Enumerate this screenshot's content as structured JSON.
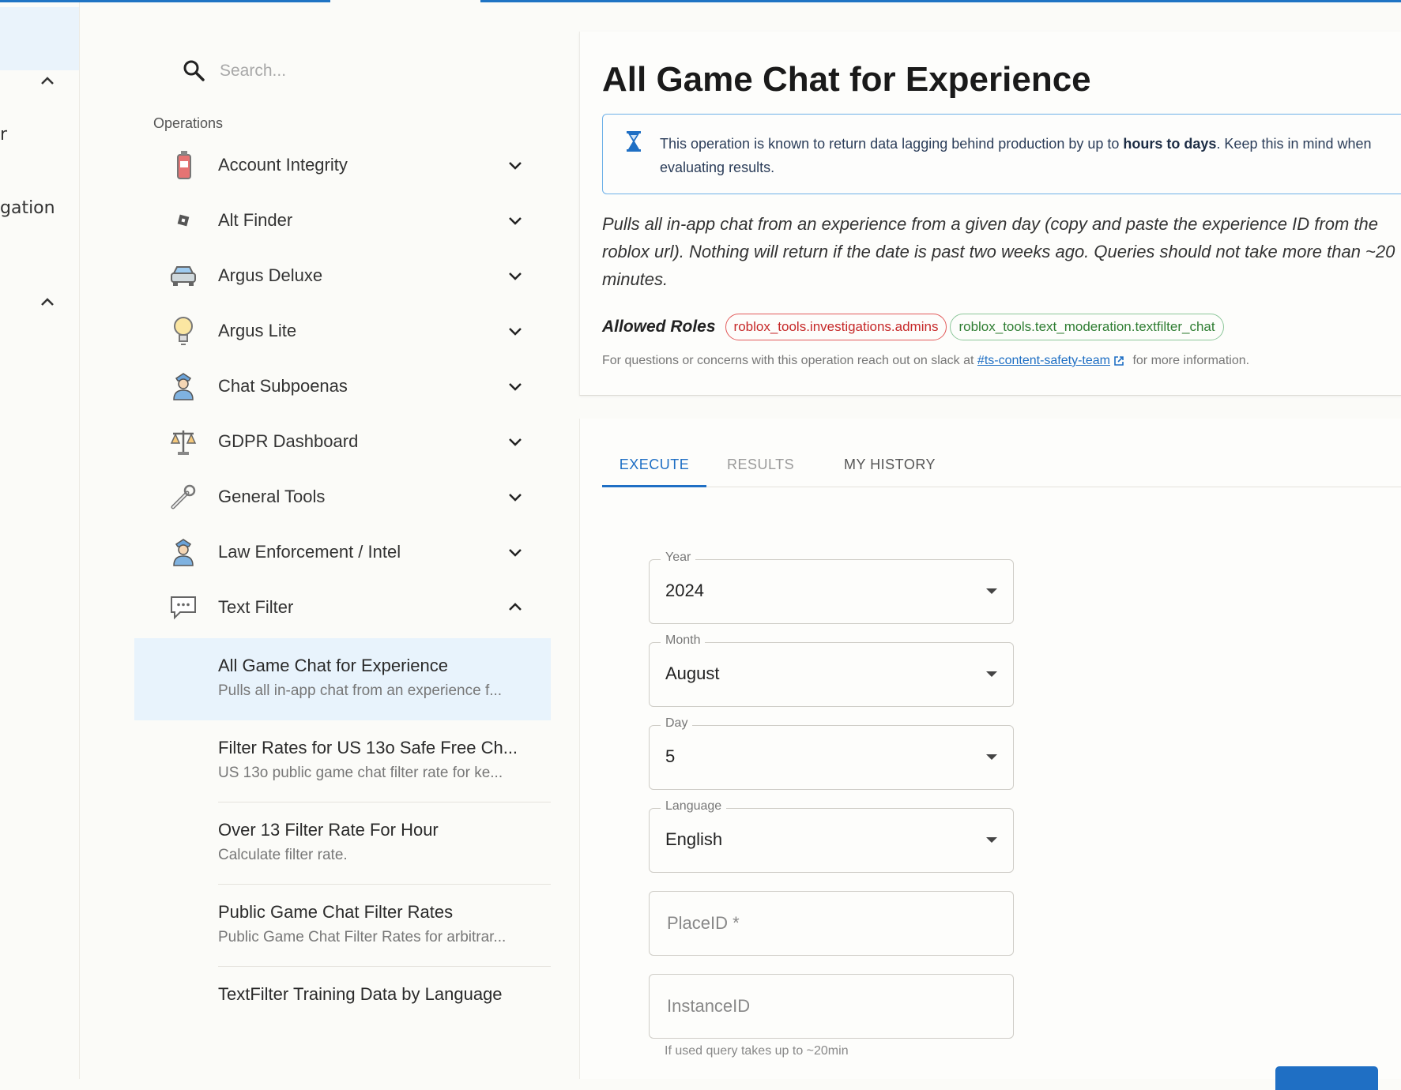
{
  "left_nav": {
    "fragment_1": "r",
    "fragment_2": "gation"
  },
  "search": {
    "placeholder": "Search..."
  },
  "operations": {
    "title": "Operations",
    "categories": [
      {
        "label": "Account Integrity",
        "icon": "fire-extinguisher-icon",
        "expanded": false
      },
      {
        "label": "Alt Finder",
        "icon": "roblox-logo-icon",
        "expanded": false
      },
      {
        "label": "Argus Deluxe",
        "icon": "car-icon",
        "expanded": false
      },
      {
        "label": "Argus Lite",
        "icon": "light-bulb-icon",
        "expanded": false
      },
      {
        "label": "Chat Subpoenas",
        "icon": "police-officer-icon",
        "expanded": false
      },
      {
        "label": "GDPR Dashboard",
        "icon": "scales-icon",
        "expanded": false
      },
      {
        "label": "General Tools",
        "icon": "wrench-icon",
        "expanded": false
      },
      {
        "label": "Law Enforcement / Intel",
        "icon": "police-officer-icon",
        "expanded": false
      },
      {
        "label": "Text Filter",
        "icon": "chat-bubble-icon",
        "expanded": true
      }
    ],
    "text_filter_items": [
      {
        "title": "All Game Chat for Experience",
        "desc": "Pulls all in-app chat from an experience f...",
        "selected": true
      },
      {
        "title": "Filter Rates for US 13o Safe Free Ch...",
        "desc": "US 13o public game chat filter rate for ke...",
        "selected": false
      },
      {
        "title": "Over 13 Filter Rate For Hour",
        "desc": "Calculate filter rate.",
        "selected": false
      },
      {
        "title": "Public Game Chat Filter Rates",
        "desc": "Public Game Chat Filter Rates for arbitrar...",
        "selected": false
      },
      {
        "title": "TextFilter Training Data by Language",
        "desc": "",
        "selected": false
      }
    ]
  },
  "detail": {
    "title": "All Game Chat for Experience",
    "notice_pre": "This operation is known to return data lagging behind production by up to ",
    "notice_bold": "hours to days",
    "notice_post": ". Keep this in mind when evaluating results.",
    "description": "Pulls all in-app chat from an experience from a given day (copy and paste the experience ID from the roblox url). Nothing will return if the date is past two weeks ago. Queries should not take more than ~20 minutes.",
    "allowed_roles_label": "Allowed Roles",
    "roles": [
      "roblox_tools.investigations.admins",
      "roblox_tools.text_moderation.textfilter_chat"
    ],
    "contact_pre": "For questions or concerns with this operation reach out on slack at ",
    "contact_link": "#ts-content-safety-team",
    "contact_post": " for more information."
  },
  "tabs": [
    "EXECUTE",
    "RESULTS",
    "MY HISTORY"
  ],
  "form": {
    "year": {
      "label": "Year",
      "value": "2024"
    },
    "month": {
      "label": "Month",
      "value": "August"
    },
    "day": {
      "label": "Day",
      "value": "5"
    },
    "language": {
      "label": "Language",
      "value": "English"
    },
    "place_id": {
      "placeholder": "PlaceID *"
    },
    "instance_id": {
      "placeholder": "InstanceID"
    },
    "helper": "If used query takes up to ~20min"
  },
  "colors": {
    "accent": "#1f6fc4",
    "selected_bg": "#e8f3fc",
    "role_red": "#c62828",
    "role_green": "#2e7d32"
  }
}
